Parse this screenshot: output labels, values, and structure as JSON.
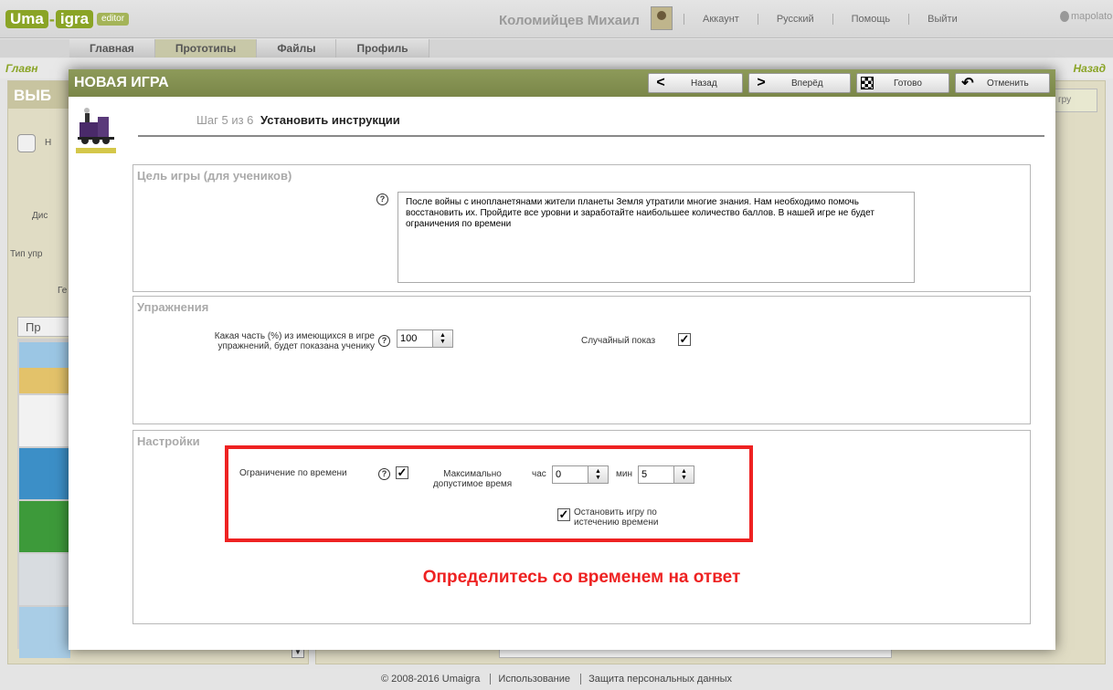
{
  "app": {
    "logo": {
      "uma": "Uma",
      "igra": "igra",
      "editor": "editor"
    },
    "user_name": "Коломийцев Михаил",
    "top_links": [
      "Аккаунт",
      "Русский",
      "Помощь",
      "Выйти"
    ],
    "partner": "mapolato",
    "nav_tabs": [
      "Главная",
      "Прототипы",
      "Файлы",
      "Профиль"
    ],
    "breadcrumb_left": "Главн",
    "breadcrumb_right": "Назад",
    "left_panel": {
      "heading": "ВЫБ",
      "labels": [
        "Н",
        "Дис",
        "Тип упр",
        "Ге"
      ],
      "tab": "Пр",
      "thumbnails": [
        "pyramids-icon",
        "train-icon",
        "cat-icon",
        "soccer-ball-icon",
        "castle-icon",
        "airplane-icon"
      ]
    },
    "right_panel": {
      "button": "гру"
    }
  },
  "footer": {
    "copyright": "© 2008-2016 Umaigra",
    "links": [
      "Использование",
      "Защита персональных данных"
    ]
  },
  "modal": {
    "title": "НОВАЯ ИГРА",
    "buttons": {
      "back": "Назад",
      "forward": "Вперёд",
      "done": "Готово",
      "cancel": "Отменить"
    },
    "step": {
      "prefix": "Шаг 5 из 6",
      "title": "Установить инструкции"
    },
    "goal": {
      "title": "Цель игры (для учеников)",
      "text": "После войны с инопланетянами жители планеты Земля утратили многие знания. Нам необходимо помочь восстановить их. Пройдите все уровни и заработайте наибольшее количество баллов. В нашей игре не будет ограничения по времени"
    },
    "exercises": {
      "title": "Упражнения",
      "percent_label": "Какая часть (%) из имеющихся в игре упражнений, будет показана ученику",
      "percent_value": "100",
      "random_label": "Случайный показ",
      "random_checked": true
    },
    "settings": {
      "title": "Настройки",
      "time_limit_label": "Ограничение по времени",
      "time_limit_checked": true,
      "max_time_label": "Максимально допустимое время",
      "hours_label": "час",
      "hours_value": "0",
      "minutes_label": "мин",
      "minutes_value": "5",
      "stop_label": "Остановить игру по истечению времени",
      "stop_checked": true
    },
    "hint": "Определитесь со временем на ответ"
  },
  "colors": {
    "brand_green": "#8aa426",
    "modal_header": "#7f8b4e",
    "highlight_red": "#e22222"
  }
}
